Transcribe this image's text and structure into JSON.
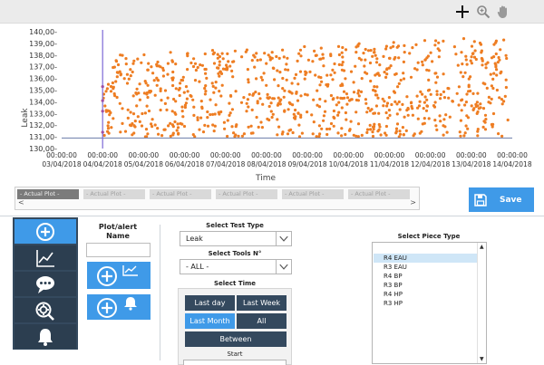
{
  "chart_data": {
    "type": "scatter",
    "title": "",
    "xlabel": "Time",
    "ylabel": "Leak",
    "ylim": [
      130.0,
      140.0
    ],
    "xlim": [
      "2018-04-03",
      "2018-04-14"
    ],
    "yticks": [
      "130,00",
      "131,00",
      "132,00",
      "133,00",
      "134,00",
      "135,00",
      "136,00",
      "137,00",
      "138,00",
      "139,00",
      "140,00"
    ],
    "xticks": [
      {
        "time": "00:00:00",
        "date": "03/04/2018"
      },
      {
        "time": "00:00:00",
        "date": "04/04/2018"
      },
      {
        "time": "00:00:00",
        "date": "05/04/2018"
      },
      {
        "time": "00:00:00",
        "date": "06/04/2018"
      },
      {
        "time": "00:00:00",
        "date": "07/04/2018"
      },
      {
        "time": "00:00:00",
        "date": "08/04/2018"
      },
      {
        "time": "00:00:00",
        "date": "09/04/2018"
      },
      {
        "time": "00:00:00",
        "date": "10/04/2018"
      },
      {
        "time": "00:00:00",
        "date": "11/04/2018"
      },
      {
        "time": "00:00:00",
        "date": "12/04/2018"
      },
      {
        "time": "00:00:00",
        "date": "13/04/2018"
      },
      {
        "time": "00:00:00",
        "date": "14/04/2018"
      }
    ],
    "cursor_date": "2018-04-04",
    "baseline_value": 130.9,
    "point_count": 900,
    "point_color": "#ee7d22",
    "series_band": {
      "lower": [
        131.0,
        131.0
      ],
      "upper": [
        138.0,
        139.6
      ],
      "date_range": [
        "2018-04-04",
        "2018-04-13"
      ]
    },
    "grid": false
  },
  "toolbar": {
    "icons": [
      "crosshair-icon",
      "zoom-icon",
      "hand-icon"
    ]
  },
  "tabs": {
    "items": [
      {
        "label": "- Actual Plot -",
        "active": true
      },
      {
        "label": "- Actual Plot -",
        "active": false
      },
      {
        "label": "- Actual Plot -",
        "active": false
      },
      {
        "label": "- Actual Plot -",
        "active": false
      },
      {
        "label": "- Actual Plot -",
        "active": false
      },
      {
        "label": "- Actual Plot -",
        "active": false
      }
    ],
    "scroll_left": "<",
    "scroll_right": ">"
  },
  "save": {
    "label": "Save",
    "color": "#3f9ae8"
  },
  "nav": {
    "items": [
      "add-icon",
      "chart-icon",
      "comment-icon",
      "search-settings-icon",
      "bell-icon"
    ],
    "active_color": "#3f9ae8",
    "bg_color": "#34495e"
  },
  "plot_alert": {
    "label": "Plot/alert Name",
    "value": ""
  },
  "filters": {
    "test_type_label": "Select Test Type",
    "test_type_value": "Leak",
    "tools_label": "Select Tools N°",
    "tools_value": "- ALL -",
    "time_label": "Select Time",
    "time_buttons": {
      "last_day": "Last day",
      "last_week": "Last Week",
      "last_month": "Last Month",
      "all": "All",
      "between": "Between"
    },
    "start_label": "Start"
  },
  "piece_type": {
    "label": "Select Piece Type",
    "items": [
      "R4 EAU",
      "R3 EAU",
      "R4 BP",
      "R3 BP",
      "R4 HP",
      "R3 HP"
    ],
    "selected": "R4 EAU"
  }
}
